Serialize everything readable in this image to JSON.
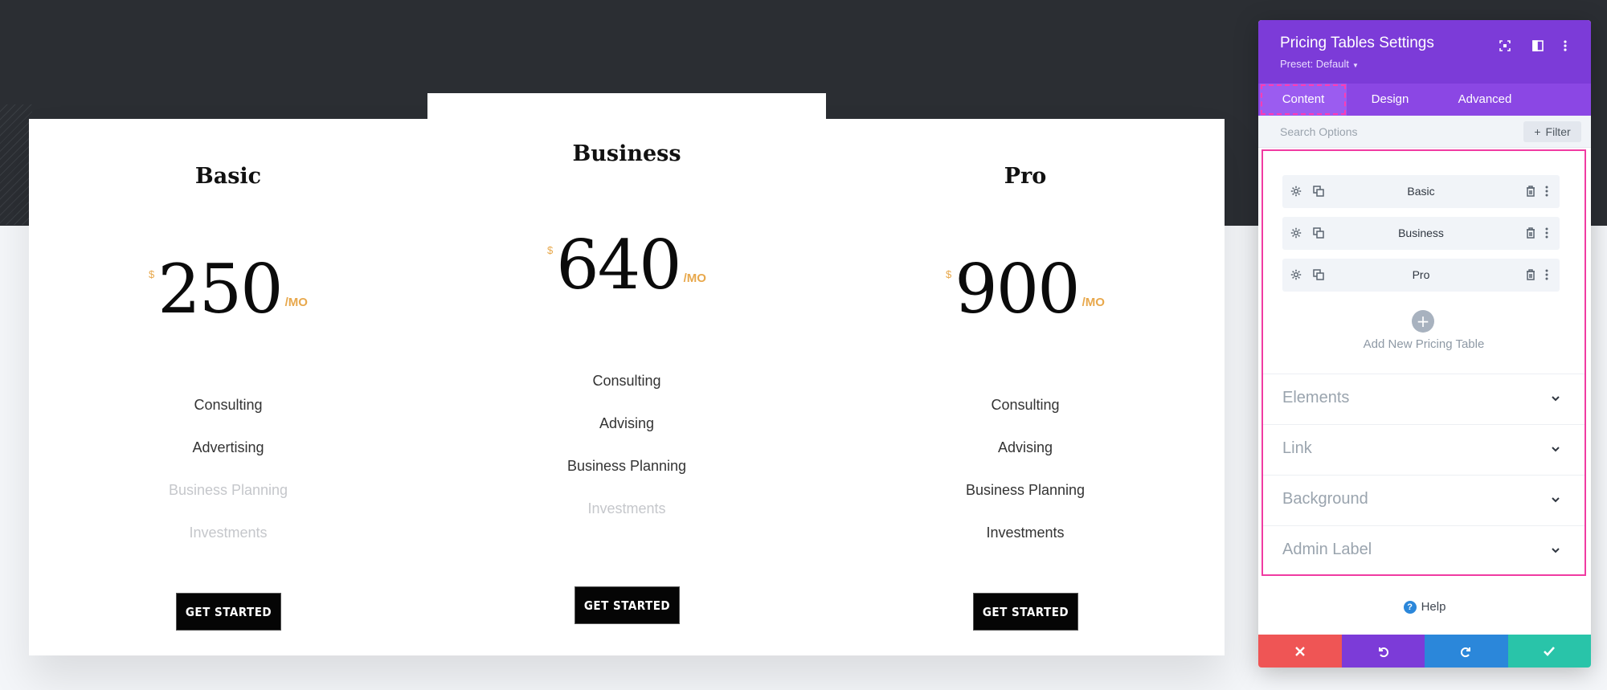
{
  "pricing": {
    "tables": [
      {
        "title": "Basic",
        "currency": "$",
        "amount": "250",
        "per": "/MO",
        "features": [
          {
            "text": "Consulting",
            "included": true
          },
          {
            "text": "Advertising",
            "included": true
          },
          {
            "text": "Business Planning",
            "included": false
          },
          {
            "text": "Investments",
            "included": false
          }
        ],
        "button": "Get Started"
      },
      {
        "title": "Business",
        "currency": "$",
        "amount": "640",
        "per": "/MO",
        "features": [
          {
            "text": "Consulting",
            "included": true
          },
          {
            "text": "Advising",
            "included": true
          },
          {
            "text": "Business Planning",
            "included": true
          },
          {
            "text": "Investments",
            "included": false
          }
        ],
        "button": "Get Started"
      },
      {
        "title": "Pro",
        "currency": "$",
        "amount": "900",
        "per": "/MO",
        "features": [
          {
            "text": "Consulting",
            "included": true
          },
          {
            "text": "Advising",
            "included": true
          },
          {
            "text": "Business Planning",
            "included": true
          },
          {
            "text": "Investments",
            "included": true
          }
        ],
        "button": "Get Started"
      }
    ]
  },
  "panel": {
    "title": "Pricing Tables Settings",
    "preset": "Preset: Default",
    "header_icons": [
      "expand-icon",
      "sidebar-layout-icon",
      "more-vertical-icon"
    ],
    "tabs": [
      {
        "label": "Content",
        "active": true
      },
      {
        "label": "Design",
        "active": false
      },
      {
        "label": "Advanced",
        "active": false
      }
    ],
    "search": {
      "placeholder": "Search Options"
    },
    "filter_label": "Filter",
    "items": [
      {
        "label": "Basic"
      },
      {
        "label": "Business"
      },
      {
        "label": "Pro"
      }
    ],
    "add_label": "Add New Pricing Table",
    "sections": [
      {
        "label": "Elements"
      },
      {
        "label": "Link"
      },
      {
        "label": "Background"
      },
      {
        "label": "Admin Label"
      }
    ],
    "help_label": "Help",
    "footer": [
      {
        "icon": "close-icon",
        "color": "#ef5555"
      },
      {
        "icon": "undo-icon",
        "color": "#7c3bd8"
      },
      {
        "icon": "redo-icon",
        "color": "#2b87da"
      },
      {
        "icon": "check-icon",
        "color": "#29c4a9"
      }
    ]
  },
  "colors": {
    "accent_gold": "#e8a84c",
    "hero_dark": "#2b2e33",
    "panel_purple": "#7c3bd8",
    "highlight_pink": "#f03ba2"
  }
}
